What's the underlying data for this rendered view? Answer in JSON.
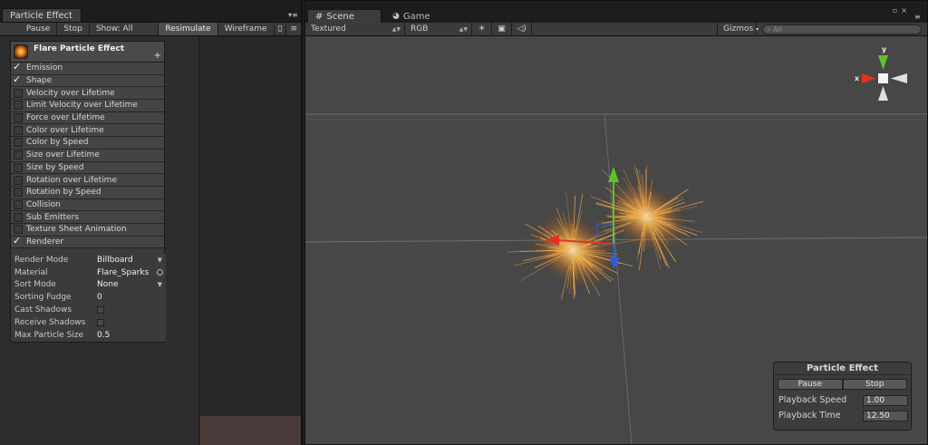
{
  "particle_panel": {
    "tab_title": "Particle Effect",
    "toolbar": {
      "pause": "Pause",
      "stop": "Stop",
      "show": "Show: All",
      "resimulate": "Resimulate",
      "wireframe": "Wireframe"
    },
    "system": {
      "title": "Flare Particle Effect",
      "modules": [
        {
          "label": "Emission",
          "checked": true
        },
        {
          "label": "Shape",
          "checked": true
        },
        {
          "label": "Velocity over Lifetime",
          "checked": false
        },
        {
          "label": "Limit Velocity over Lifetime",
          "checked": false
        },
        {
          "label": "Force over Lifetime",
          "checked": false
        },
        {
          "label": "Color over Lifetime",
          "checked": false
        },
        {
          "label": "Color by Speed",
          "checked": false
        },
        {
          "label": "Size over Lifetime",
          "checked": false
        },
        {
          "label": "Size by Speed",
          "checked": false
        },
        {
          "label": "Rotation over Lifetime",
          "checked": false
        },
        {
          "label": "Rotation by Speed",
          "checked": false
        },
        {
          "label": "Collision",
          "checked": false
        },
        {
          "label": "Sub Emitters",
          "checked": false
        },
        {
          "label": "Texture Sheet Animation",
          "checked": false
        },
        {
          "label": "Renderer",
          "checked": true
        }
      ],
      "renderer": {
        "render_mode_label": "Render Mode",
        "render_mode_value": "Billboard",
        "material_label": "Material",
        "material_value": "Flare_Sparks",
        "sort_mode_label": "Sort Mode",
        "sort_mode_value": "None",
        "sorting_fudge_label": "Sorting Fudge",
        "sorting_fudge_value": "0",
        "cast_shadows_label": "Cast Shadows",
        "receive_shadows_label": "Receive Shadows",
        "max_particle_size_label": "Max Particle Size",
        "max_particle_size_value": "0.5"
      }
    }
  },
  "scene_panel": {
    "tabs": [
      {
        "label": "Scene",
        "icon": "grid-icon",
        "active": true
      },
      {
        "label": "Game",
        "icon": "pacman-icon",
        "active": false
      }
    ],
    "toolbar": {
      "draw_mode": "Textured",
      "render_mode": "RGB",
      "gizmos": "Gizmos",
      "search_placeholder": "All"
    },
    "gizmo_axes": {
      "x": "x",
      "y": "y"
    },
    "overlay": {
      "title": "Particle Effect",
      "pause": "Pause",
      "stop": "Stop",
      "playback_speed_label": "Playback Speed",
      "playback_speed_value": "1.00",
      "playback_time_label": "Playback Time",
      "playback_time_value": "12.50"
    }
  },
  "colors": {
    "axis_x": "#e0341f",
    "axis_y": "#5ec32a",
    "axis_z": "#2c5fdc",
    "spark": "#ffb347"
  }
}
